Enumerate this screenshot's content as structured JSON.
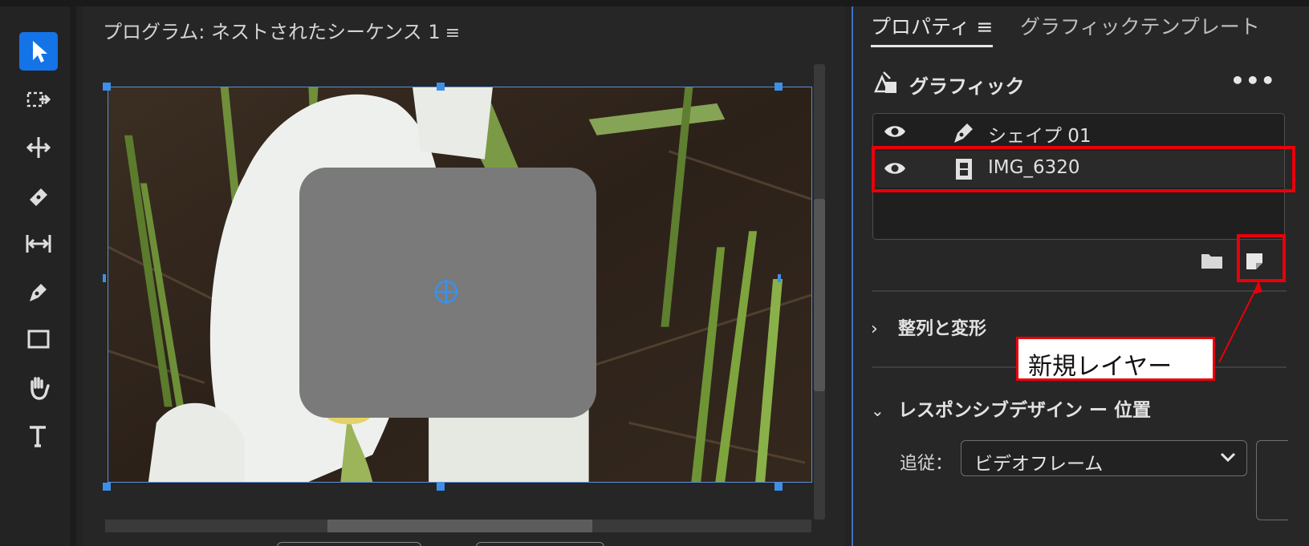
{
  "program": {
    "title": "プログラム: ネストされたシーケンス 1",
    "menu_glyph": "≡"
  },
  "toolbar": {
    "tools": [
      {
        "name": "selection-tool",
        "icon": "arrow-icon",
        "active": true
      },
      {
        "name": "track-select-tool",
        "icon": "track-select-icon"
      },
      {
        "name": "ripple-edit-tool",
        "icon": "ripple-edit-icon"
      },
      {
        "name": "razor-tool",
        "icon": "razor-icon"
      },
      {
        "name": "slip-tool",
        "icon": "slip-icon"
      },
      {
        "name": "pen-tool",
        "icon": "pen-icon"
      },
      {
        "name": "rectangle-tool",
        "icon": "rectangle-icon"
      },
      {
        "name": "hand-tool",
        "icon": "hand-icon"
      },
      {
        "name": "type-tool",
        "icon": "type-icon"
      }
    ],
    "active_color": "#1473e6"
  },
  "properties": {
    "tab_properties": "プロパティ ≡",
    "tab_graphic_templates": "グラフィックテンプレート",
    "graphic_heading": "グラフィック",
    "more_label": "•••",
    "layers": [
      {
        "name": "シェイプ 01",
        "type_icon": "pen-icon",
        "visible": true
      },
      {
        "name": "IMG_6320",
        "type_icon": "film-icon",
        "visible": true
      }
    ],
    "align_section": "整列と変形",
    "align_chevron": "›",
    "responsive_section": "レスポンシブデザイン ー 位置",
    "responsive_chevron": "⌄",
    "follow_label": "追従：",
    "follow_value": "ビデオフレーム"
  },
  "annotation": {
    "callout_text": "新規レイヤー",
    "highlight_color": "#e8000a"
  }
}
